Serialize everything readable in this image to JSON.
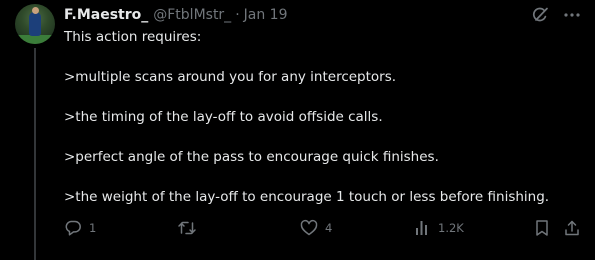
{
  "post": {
    "author_name": "F.Maestro_",
    "handle": "@FtblMstr_",
    "separator": "·",
    "date": "Jan 19",
    "lines": [
      "This action requires:",
      ">multiple scans around you for any interceptors.",
      ">the timing of the lay-off to avoid offside calls.",
      ">perfect angle of the pass to encourage quick finishes.",
      ">the weight of the lay-off to encourage 1 touch or less before finishing."
    ]
  },
  "actions": {
    "reply_count": "1",
    "repost_count": "",
    "like_count": "4",
    "view_count": "1.2K"
  },
  "icons": {
    "grok": "grok-icon",
    "more": "more-icon",
    "reply": "reply-icon",
    "repost": "repost-icon",
    "like": "like-icon",
    "views": "views-icon",
    "bookmark": "bookmark-icon",
    "share": "share-icon"
  },
  "colors": {
    "background": "#000000",
    "text": "#e7e9ea",
    "muted": "#71767b",
    "divider": "#333639"
  }
}
